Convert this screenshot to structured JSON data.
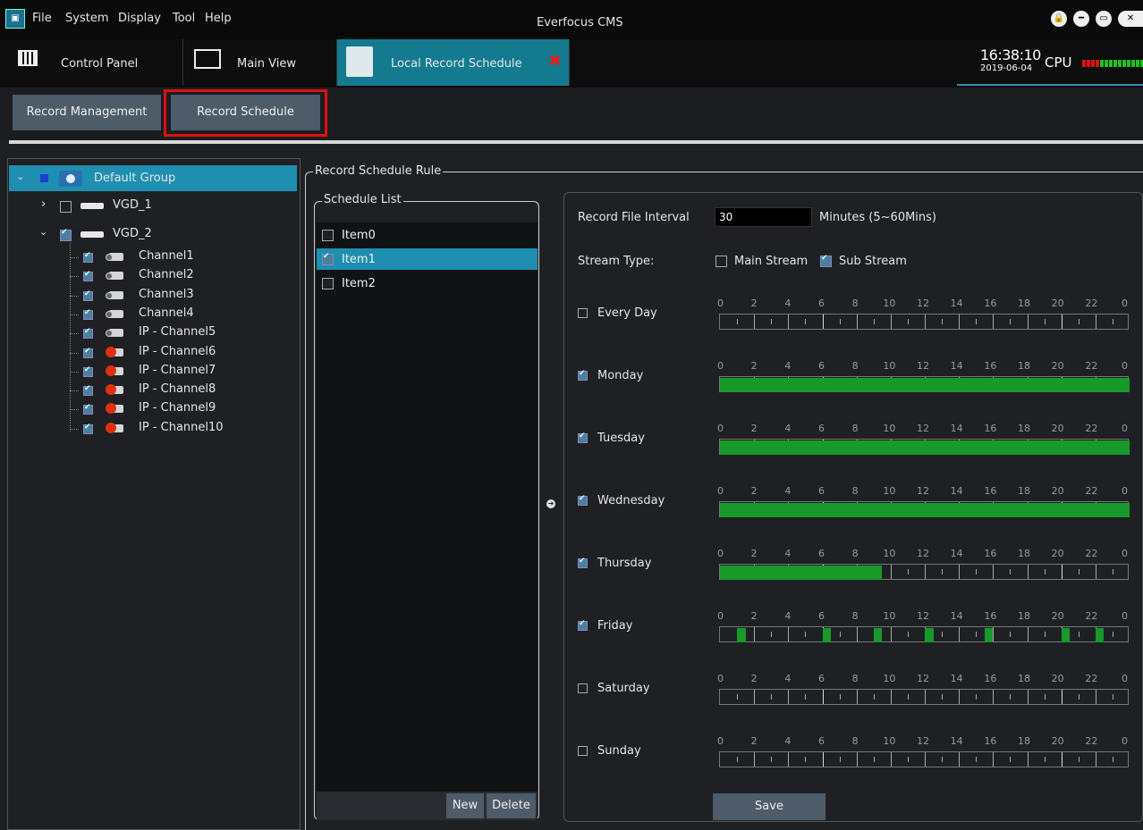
{
  "menu": {
    "app_icon": "cms-icon",
    "items": [
      "File",
      "System",
      "Display",
      "Tool",
      "Help"
    ]
  },
  "app_title": "Everfocus CMS",
  "window_controls": [
    "lock-icon",
    "minimize-icon",
    "maximize-icon",
    "close-icon"
  ],
  "tabs": [
    {
      "label": "Control Panel",
      "icon": "keyboard-icon"
    },
    {
      "label": "Main View",
      "icon": "monitor-icon"
    },
    {
      "label": "Local Record Schedule",
      "icon": "record-schedule-icon",
      "active": true,
      "close": "✖"
    }
  ],
  "status": {
    "time": "16:38:10",
    "date": "2019-06-04",
    "cpu_label": "CPU"
  },
  "subtoolbar": {
    "record_management": "Record Management",
    "record_schedule": "Record Schedule"
  },
  "tree": {
    "root": "Default Group",
    "devices": [
      {
        "name": "VGD_1",
        "checked": false,
        "expanded": false
      },
      {
        "name": "VGD_2",
        "checked": true,
        "expanded": true
      }
    ],
    "channels": [
      "Channel1",
      "Channel2",
      "Channel3",
      "Channel4",
      "IP - Channel5",
      "IP - Channel6",
      "IP - Channel7",
      "IP - Channel8",
      "IP - Channel9",
      "IP - Channel10"
    ]
  },
  "rule": {
    "group_title": "Record Schedule Rule",
    "list_title": "Schedule List",
    "items": [
      {
        "label": "Item0",
        "checked": false,
        "selected": false
      },
      {
        "label": "Item1",
        "checked": true,
        "selected": true
      },
      {
        "label": "Item2",
        "checked": false,
        "selected": false
      }
    ],
    "new_label": "New",
    "delete_label": "Delete",
    "interval_label": "Record File Interval",
    "interval_value": "30",
    "interval_unit": "Minutes (5~60Mins)",
    "stream_label": "Stream Type:",
    "main_stream": "Main Stream",
    "sub_stream": "Sub Stream",
    "main_stream_checked": false,
    "sub_stream_checked": true,
    "hour_ticks": [
      "0",
      "2",
      "4",
      "6",
      "8",
      "10",
      "12",
      "14",
      "16",
      "18",
      "20",
      "22",
      "0"
    ],
    "days": [
      {
        "label": "Every Day",
        "checked": false,
        "ranges": []
      },
      {
        "label": "Monday",
        "checked": true,
        "ranges": [
          [
            0,
            24
          ]
        ]
      },
      {
        "label": "Tuesday",
        "checked": true,
        "ranges": [
          [
            0,
            24
          ]
        ]
      },
      {
        "label": "Wednesday",
        "checked": true,
        "ranges": [
          [
            0,
            24
          ]
        ]
      },
      {
        "label": "Thursday",
        "checked": true,
        "ranges": [
          [
            0,
            9.5
          ]
        ]
      },
      {
        "label": "Friday",
        "checked": true,
        "ranges": [
          [
            1,
            1.5
          ],
          [
            6,
            6.5
          ],
          [
            9,
            9.5
          ],
          [
            12,
            12.5
          ],
          [
            15.5,
            16
          ],
          [
            20,
            20.5
          ],
          [
            22,
            22.5
          ]
        ]
      },
      {
        "label": "Saturday",
        "checked": false,
        "ranges": []
      },
      {
        "label": "Sunday",
        "checked": false,
        "ranges": []
      }
    ],
    "save_label": "Save"
  }
}
